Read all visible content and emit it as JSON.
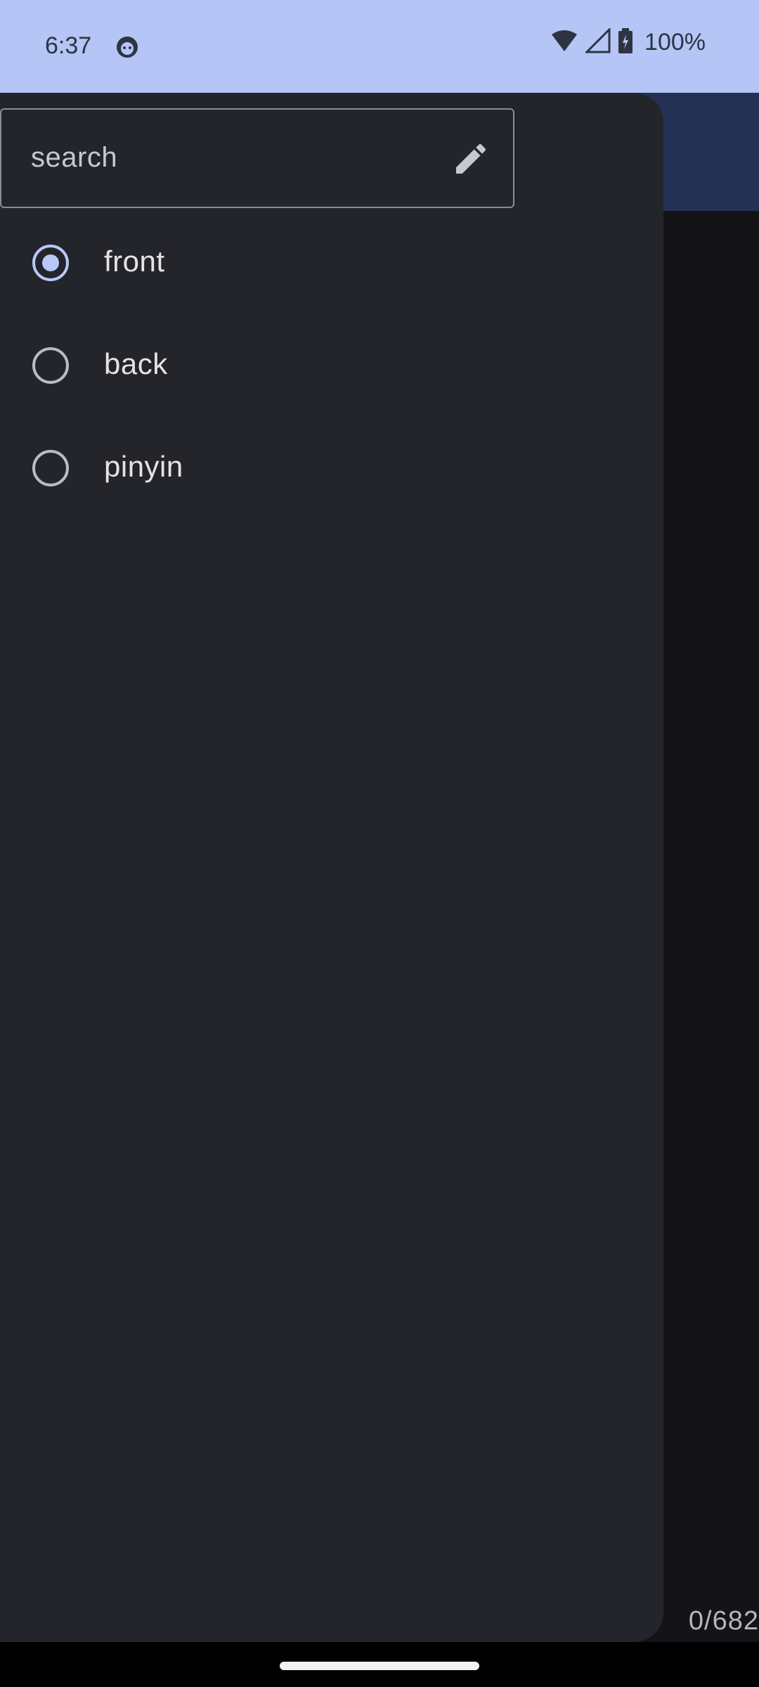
{
  "status_bar": {
    "time": "6:37",
    "battery": "100%",
    "icons": [
      "face-icon",
      "wifi-icon",
      "signal-icon",
      "battery-icon"
    ]
  },
  "drawer": {
    "search": {
      "placeholder": "search",
      "icon": "pencil-icon"
    },
    "options": [
      {
        "label": "front",
        "selected": true
      },
      {
        "label": "back",
        "selected": false
      },
      {
        "label": "pinyin",
        "selected": false
      }
    ]
  },
  "main": {
    "counter": "0/682"
  },
  "colors": {
    "status_bar_bg": "#b4c5f6",
    "drawer_bg": "#23252b",
    "accent": "#b8c8f8",
    "app_bar_bg": "#243154"
  }
}
